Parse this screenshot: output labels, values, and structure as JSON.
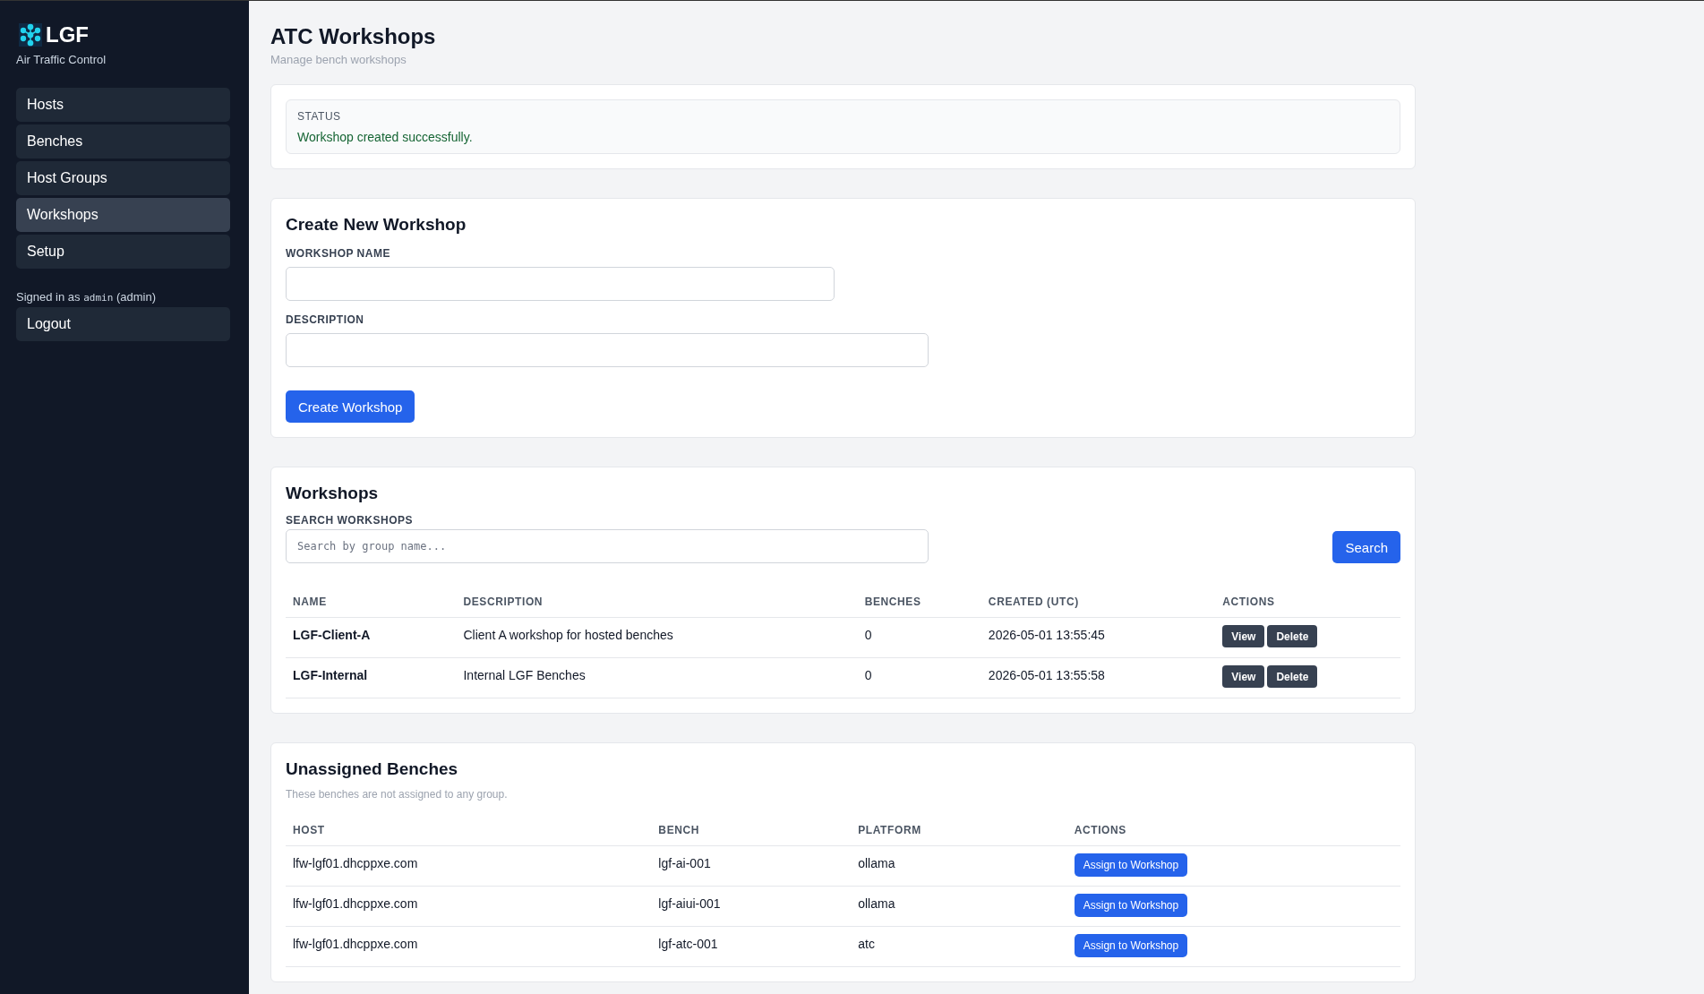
{
  "sidebar": {
    "brand": "LGF",
    "subtitle": "Air Traffic Control",
    "items": [
      {
        "label": "Hosts",
        "selected": false
      },
      {
        "label": "Benches",
        "selected": false
      },
      {
        "label": "Host Groups",
        "selected": false
      },
      {
        "label": "Workshops",
        "selected": true
      },
      {
        "label": "Setup",
        "selected": false
      }
    ],
    "signed_in": {
      "prefix": "Signed in as",
      "user": "admin",
      "role": "(admin)"
    },
    "logout": "Logout"
  },
  "header": {
    "title": "ATC Workshops",
    "subtitle": "Manage bench workshops"
  },
  "status": {
    "label": "STATUS",
    "message": "Workshop created successfully."
  },
  "create_form": {
    "title": "Create New Workshop",
    "fields": [
      {
        "label": "WORKSHOP NAME",
        "kind": "short"
      },
      {
        "label": "DESCRIPTION",
        "kind": "long"
      }
    ],
    "submit": "Create Workshop"
  },
  "workshops": {
    "title": "Workshops",
    "search_label": "SEARCH WORKSHOPS",
    "search_placeholder": "Search by group name...",
    "search_button": "Search",
    "columns": [
      "NAME",
      "DESCRIPTION",
      "BENCHES",
      "CREATED (UTC)",
      "ACTIONS"
    ],
    "rows": [
      {
        "name": "LGF-Client-A",
        "description": "Client A workshop for hosted benches",
        "benches": "0",
        "created": "2026-05-01 13:55:45",
        "actions": [
          "View",
          "Delete"
        ]
      },
      {
        "name": "LGF-Internal",
        "description": "Internal LGF Benches",
        "benches": "0",
        "created": "2026-05-01 13:55:58",
        "actions": [
          "View",
          "Delete"
        ]
      }
    ]
  },
  "unassigned": {
    "title": "Unassigned Benches",
    "note": "These benches are not assigned to any group.",
    "columns": [
      "HOST",
      "BENCH",
      "PLATFORM",
      "ACTIONS"
    ],
    "rows": [
      {
        "host": "lfw-lgf01.dhcppxe.com",
        "bench": "lgf-ai-001",
        "platform": "ollama",
        "action": "Assign to Workshop"
      },
      {
        "host": "lfw-lgf01.dhcppxe.com",
        "bench": "lgf-aiui-001",
        "platform": "ollama",
        "action": "Assign to Workshop"
      },
      {
        "host": "lfw-lgf01.dhcppxe.com",
        "bench": "lgf-atc-001",
        "platform": "atc",
        "action": "Assign to Workshop"
      }
    ]
  }
}
